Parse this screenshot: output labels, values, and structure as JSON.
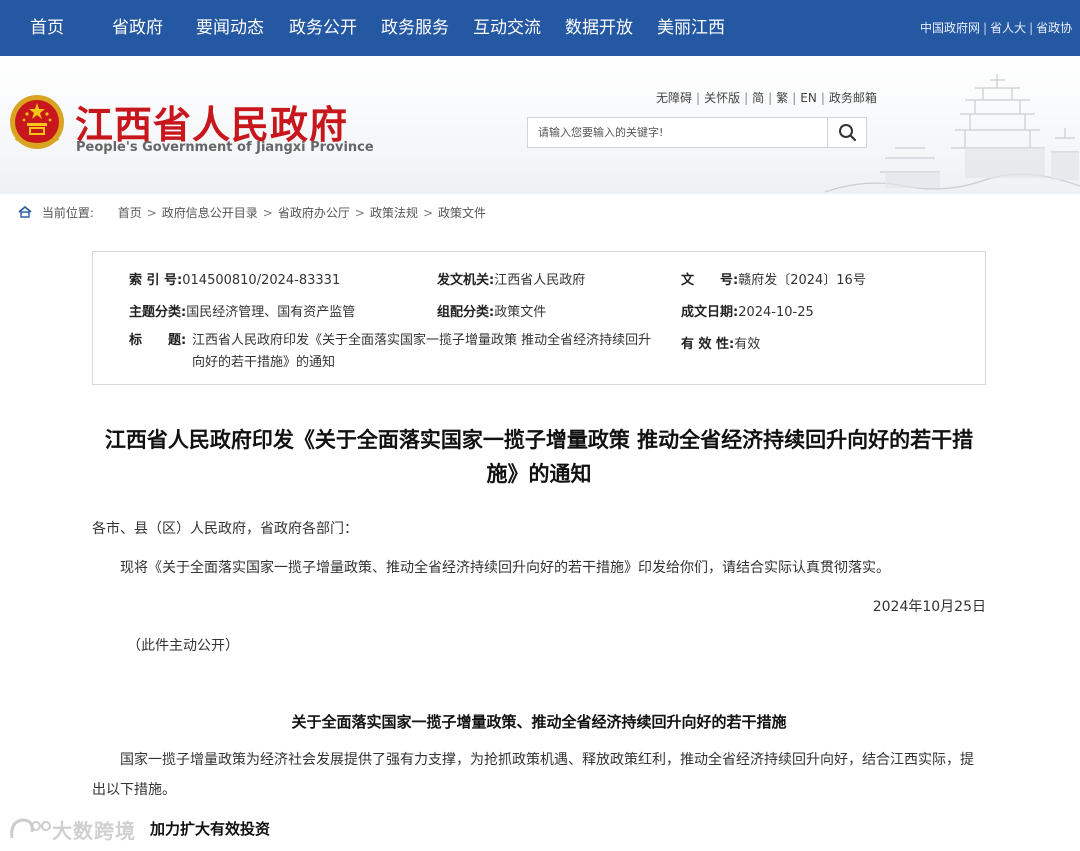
{
  "nav": {
    "items": [
      "首页",
      "省政府",
      "要闻动态",
      "政务公开",
      "政务服务",
      "互动交流",
      "数据开放",
      "美丽江西"
    ],
    "top_links": [
      "中国政府网",
      "省人大",
      "省政协"
    ]
  },
  "header": {
    "title_cn": "江西省人民政府",
    "title_en": "People's Government of Jiangxi Province",
    "util_links": [
      "无障碍",
      "关怀版",
      "简",
      "繁",
      "EN",
      "政务邮箱"
    ],
    "search_placeholder": "请输入您要输入的关键字!"
  },
  "breadcrumb": {
    "label": "当前位置:",
    "items": [
      "首页",
      "政府信息公开目录",
      "省政府办公厅",
      "政策法规",
      "政策文件"
    ]
  },
  "meta": {
    "index_label": "索 引 号:",
    "index_value": "014500810/2024-83331",
    "issuer_label": "发文机关:",
    "issuer_value": "江西省人民政府",
    "docno_label": "文　　号:",
    "docno_value": "赣府发〔2024〕16号",
    "topic_label": "主题分类:",
    "topic_value": "国民经济管理、国有资产监管",
    "category_label": "组配分类:",
    "category_value": "政策文件",
    "date_label": "成文日期:",
    "date_value": "2024-10-25",
    "title_label": "标　　题:",
    "title_value": "江西省人民政府印发《关于全面落实国家一揽子增量政策 推动全省经济持续回升向好的若干措施》的通知",
    "validity_label": "有 效 性:",
    "validity_value": "有效"
  },
  "article": {
    "title": "江西省人民政府印发《关于全面落实国家一揽子增量政策 推动全省经济持续回升向好的若干措施》的通知",
    "salutation": "各市、县（区）人民政府，省政府各部门：",
    "body1": "现将《关于全面落实国家一揽子增量政策、推动全省经济持续回升向好的若干措施》印发给你们，请结合实际认真贯彻落实。",
    "date": "2024年10月25日",
    "public_note": "（此件主动公开）",
    "sub_title": "关于全面落实国家一揽子增量政策、推动全省经济持续回升向好的若干措施",
    "body2": "国家一揽子增量政策为经济社会发展提供了强有力支撑，为抢抓政策机遇、释放政策红利，推动全省经济持续回升向好，结合江西实际，提出以下措施。",
    "section1": "加力扩大有效投资"
  },
  "watermark": {
    "text": "大数跨境"
  },
  "colors": {
    "nav_bg": "#2558a2",
    "title_red": "#c8161d"
  }
}
